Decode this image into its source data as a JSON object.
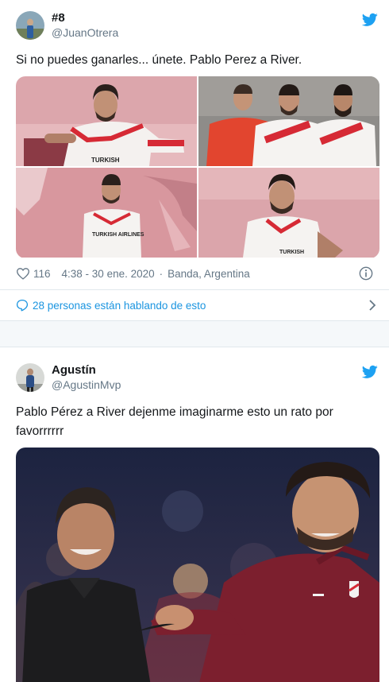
{
  "tweets": [
    {
      "display_name": "#8",
      "handle": "@JuanOtrera",
      "text": "Si no puedes ganarles... únete. Pablo Perez a River.",
      "likes": "116",
      "timestamp": "4:38 - 30 ene. 2020",
      "location": "Banda, Argentina",
      "conversation": "28 personas están hablando de esto",
      "icons": [
        "twitter-bird-icon",
        "heart-icon",
        "info-icon",
        "speech-bubble-icon",
        "chevron-right-icon"
      ],
      "media": [
        {
          "name": "player-seated-river-jersey",
          "jersey_text": "TURKISH"
        },
        {
          "name": "three-players-river-kits"
        },
        {
          "name": "player-standing-river-jersey",
          "jersey_text": "TURKISH AIRLINES"
        },
        {
          "name": "player-closeup-river-jersey",
          "jersey_text": "TURKISH"
        }
      ]
    },
    {
      "display_name": "Agustín",
      "handle": "@AgustinMvp",
      "text": "Pablo Pérez a River dejenme imaginarme esto un rato por favorrrrrr",
      "icons": [
        "twitter-bird-icon"
      ],
      "media": [
        {
          "name": "coach-handshake-player-photo"
        }
      ]
    }
  ],
  "colors": {
    "twitter_blue": "#1da1f2",
    "link_blue": "#1b95e0",
    "secondary_text": "#657786",
    "border": "#e1e8ed",
    "page_bg": "#f5f8fa"
  }
}
